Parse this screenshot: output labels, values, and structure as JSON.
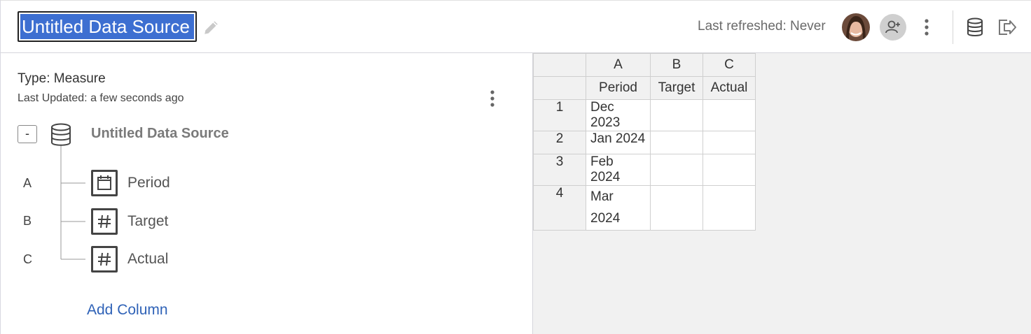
{
  "header": {
    "title": "Untitled Data Source",
    "last_refreshed": "Last refreshed: Never",
    "icons": [
      "pencil-icon",
      "avatar",
      "add-user-icon",
      "kebab-menu-icon",
      "database-icon",
      "exit-icon"
    ]
  },
  "left": {
    "type": "Type: Measure",
    "last_updated": "Last Updated: a few seconds ago",
    "collapse_label": "-",
    "source_name": "Untitled Data Source",
    "columns": [
      {
        "letter": "A",
        "name": "Period",
        "type_icon": "calendar-icon"
      },
      {
        "letter": "B",
        "name": "Target",
        "type_icon": "hash-icon"
      },
      {
        "letter": "C",
        "name": "Actual",
        "type_icon": "hash-icon"
      }
    ],
    "add_column": "Add Column"
  },
  "sheet": {
    "col_letters": [
      "A",
      "B",
      "C"
    ],
    "col_names": [
      "Period",
      "Target",
      "Actual"
    ],
    "rows": [
      {
        "num": "1",
        "cells": [
          "Dec 2023",
          "",
          ""
        ]
      },
      {
        "num": "2",
        "cells": [
          "Jan 2024",
          "",
          ""
        ]
      },
      {
        "num": "3",
        "cells": [
          "Feb 2024",
          "",
          ""
        ]
      },
      {
        "num": "4",
        "cells": [
          "Mar 2024",
          "",
          ""
        ]
      }
    ]
  },
  "colors": {
    "selection": "#3d6fd1",
    "link": "#2f62b7",
    "grid_bg": "#f1f1f1"
  }
}
